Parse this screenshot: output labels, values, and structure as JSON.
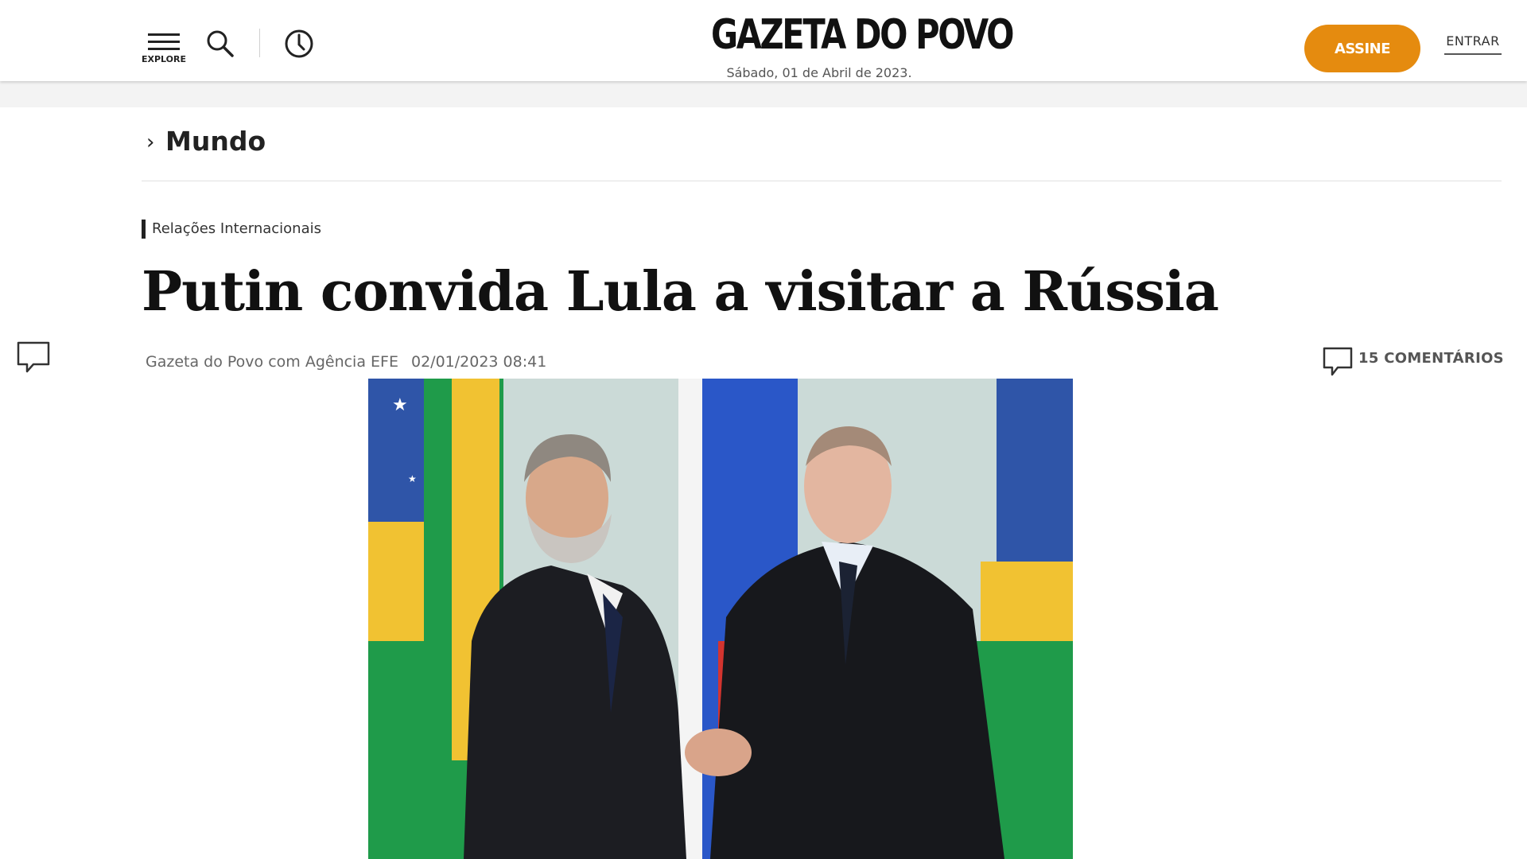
{
  "header": {
    "menu_label": "EXPLORE",
    "logo": "GAZETA DO POVO",
    "date": "Sábado, 01 de Abril de 2023.",
    "subscribe_label": "ASSINE",
    "login_label": "ENTRAR",
    "accent_color": "#e58b0f",
    "icons": [
      "menu-icon",
      "search-icon",
      "history-icon"
    ]
  },
  "section": {
    "chevron": "›",
    "title": "Mundo"
  },
  "article": {
    "tag": "Relações Internacionais",
    "headline": "Putin convida Lula a visitar a Rússia",
    "author": "Gazeta do Povo com Agência EFE",
    "timestamp": "02/01/2023 08:41",
    "comments_label": "15 COMENTÁRIOS"
  }
}
